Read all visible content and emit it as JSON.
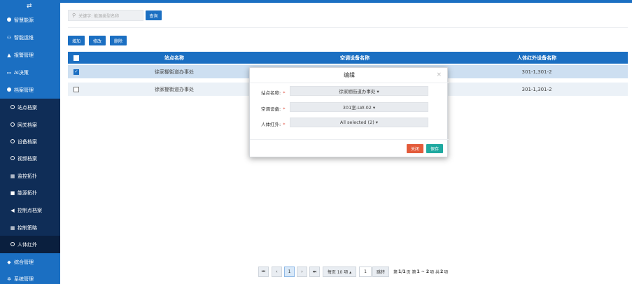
{
  "sidebar": {
    "toggle_icon": "swap-icon",
    "items": [
      {
        "label": "智慧能源",
        "icon": "dot-icon"
      },
      {
        "label": "智能运维",
        "icon": "sitemap-icon"
      },
      {
        "label": "报警管理",
        "icon": "bell-icon"
      },
      {
        "label": "AI决策",
        "icon": "monitor-icon"
      },
      {
        "label": "档案管理",
        "icon": "dot-icon"
      }
    ],
    "subitems": [
      {
        "label": "站点档案",
        "icon": "ring-icon"
      },
      {
        "label": "网关档案",
        "icon": "ring-icon"
      },
      {
        "label": "设备档案",
        "icon": "ring-icon"
      },
      {
        "label": "视频档案",
        "icon": "ring-icon"
      },
      {
        "label": "监控拓扑",
        "icon": "grid-icon"
      },
      {
        "label": "能源拓扑",
        "icon": "square-icon"
      },
      {
        "label": "控制点档案",
        "icon": "megaphone-icon"
      },
      {
        "label": "控制策略",
        "icon": "grid-icon"
      },
      {
        "label": "人体红外",
        "icon": "ring-icon",
        "active": true
      }
    ],
    "bottom_items": [
      {
        "label": "综合管理",
        "icon": "tag-icon"
      },
      {
        "label": "系统管理",
        "icon": "gear-icon"
      }
    ]
  },
  "search": {
    "placeholder": "关键字: 能源类型名称",
    "button": "查询"
  },
  "toolbar": {
    "add": "增加",
    "edit": "修改",
    "delete": "删除"
  },
  "table": {
    "headers": [
      "站点名称",
      "空调设备名称",
      "人体红外设备名称"
    ],
    "rows": [
      {
        "checked": true,
        "site": "徐家棚街道办事处",
        "device": "",
        "infrared": "301-1,301-2"
      },
      {
        "checked": false,
        "site": "徐家棚街道办事处",
        "device": "",
        "infrared": "301-1,301-2"
      }
    ]
  },
  "modal": {
    "title": "编辑",
    "close_icon": "×",
    "fields": [
      {
        "label": "站点名称:",
        "value": "徐家棚街道办事处 ▾"
      },
      {
        "label": "空调设备:",
        "value": "301室-LW-02 ▾"
      },
      {
        "label": "人体红外:",
        "value": "All selected (2) ▾"
      }
    ],
    "required_mark": "*",
    "close_button": "关闭",
    "save_button": "保存"
  },
  "pagination": {
    "first": "⏮",
    "prev": "‹",
    "current": "1",
    "next": "›",
    "last": "⏭",
    "page_size": "每页 10 项 ▴",
    "jump_input": "1",
    "jump_button": "跳转",
    "info_page_prefix": "第",
    "info_page": "1/1",
    "info_page_suffix": "页",
    "info_range_prefix": "第",
    "info_range": "1 ~ 2",
    "info_range_suffix": "项",
    "info_total_prefix": "共",
    "info_total": "2",
    "info_total_suffix": "项"
  },
  "colors": {
    "primary": "#1b6fc2",
    "sidebar_sub": "#0f2d57",
    "close": "#e35b3b",
    "save": "#1fa9a0"
  }
}
